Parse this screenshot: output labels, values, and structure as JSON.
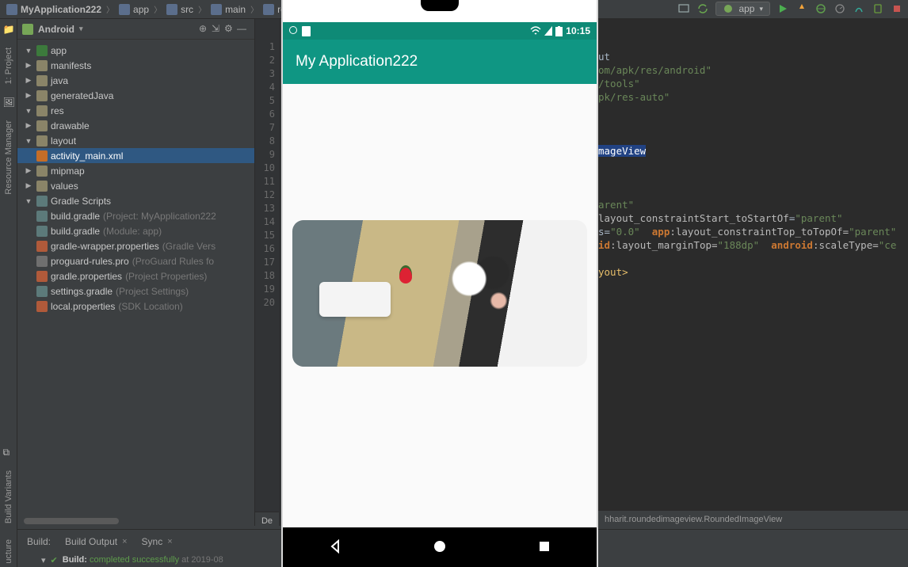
{
  "breadcrumb": [
    "MyApplication222",
    "app",
    "src",
    "main",
    "re"
  ],
  "runConfig": "app",
  "sideTabs": {
    "project": "1: Project",
    "resmgr": "Resource Manager",
    "buildvar": "Build Variants",
    "struct": "ucture"
  },
  "projectView": {
    "mode": "Android",
    "tree": {
      "app": "app",
      "manifests": "manifests",
      "java": "java",
      "generatedJava": "generatedJava",
      "res": "res",
      "drawable": "drawable",
      "layout": "layout",
      "activity_main": "activity_main.xml",
      "mipmap": "mipmap",
      "values": "values",
      "gradleScripts": "Gradle Scripts",
      "buildGradleProj": "build.gradle",
      "buildGradleProjHint": "(Project: MyApplication222",
      "buildGradleMod": "build.gradle",
      "buildGradleModHint": "(Module: app)",
      "gradleWrapper": "gradle-wrapper.properties",
      "gradleWrapperHint": "(Gradle Vers",
      "proguard": "proguard-rules.pro",
      "proguardHint": "(ProGuard Rules fo",
      "gradleProps": "gradle.properties",
      "gradlePropsHint": "(Project Properties)",
      "settingsGradle": "settings.gradle",
      "settingsGradleHint": "(Project Settings)",
      "localProps": "local.properties",
      "localPropsHint": "(SDK Location)"
    }
  },
  "gutter": [
    "1",
    "2",
    "3",
    "4",
    "5",
    "6",
    "7",
    "8",
    "9",
    "10",
    "11",
    "12",
    "13",
    "14",
    "15",
    "16",
    "17",
    "18",
    "19",
    "20"
  ],
  "code": {
    "l1": "ut",
    "l2a": "om/apk/res/android\"",
    "l3a": "/tools\"",
    "l4a": "pk/res-auto\"",
    "l8": "mageView",
    "l12a": "arent\"",
    "l13_attr": "layout_constraintStart_toStartOf",
    "l13_val": "\"parent\"",
    "l14_pre": "s=",
    "l14_val1": "\"0.0\"",
    "l14_ns": "app",
    "l14_attr": ":layout_constraintTop_toTopOf=",
    "l14_val2": "\"parent\"",
    "l15_ns1": "id",
    "l15_a1": ":layout_marginTop=",
    "l15_v1": "\"188dp\"",
    "l15_ns2": "android",
    "l15_a2": ":scaleType=",
    "l15_v2": "\"ce",
    "l17": "yout>"
  },
  "editorCrumb": "hharit.roundedimageview.RoundedImageView",
  "designTab": "De",
  "build": {
    "label": "Build:",
    "tab1": "Build Output",
    "tab2": "Sync",
    "status_prefix": "Build:",
    "status_msg": "completed successfully",
    "status_time": "at 2019-08"
  },
  "phone": {
    "time": "10:15",
    "appTitle": "My Application222"
  }
}
